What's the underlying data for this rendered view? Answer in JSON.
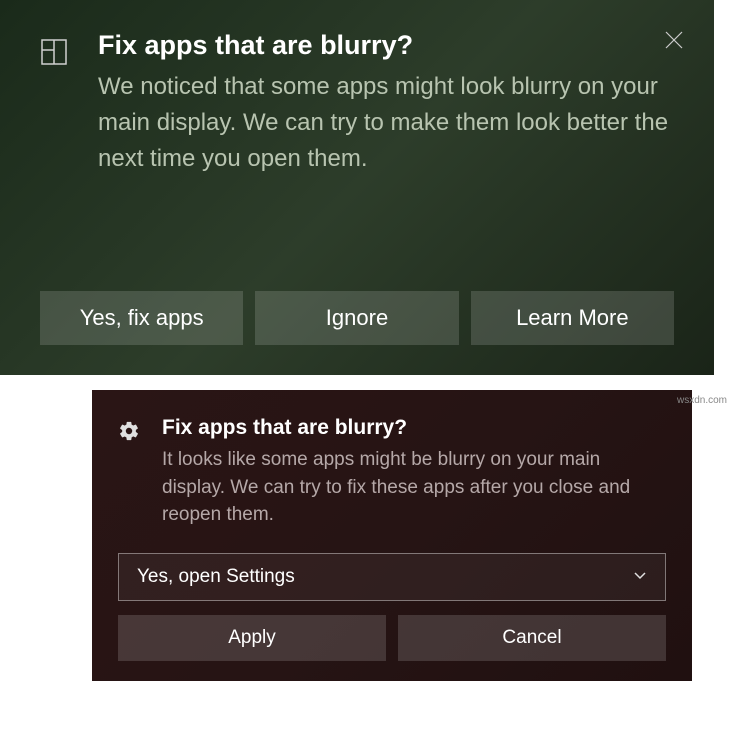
{
  "notification1": {
    "title": "Fix apps that are blurry?",
    "body": "We noticed that some apps might look blurry on your main display. We can try to make them look better the next time you open them.",
    "buttons": {
      "yes": "Yes, fix apps",
      "ignore": "Ignore",
      "learn": "Learn More"
    }
  },
  "notification2": {
    "title": "Fix apps that are blurry?",
    "body": "It looks like some apps might be blurry on your main display. We can try to fix these apps after you close and reopen them.",
    "select": {
      "value": "Yes, open Settings"
    },
    "buttons": {
      "apply": "Apply",
      "cancel": "Cancel"
    }
  },
  "watermark": "wsxdn.com"
}
